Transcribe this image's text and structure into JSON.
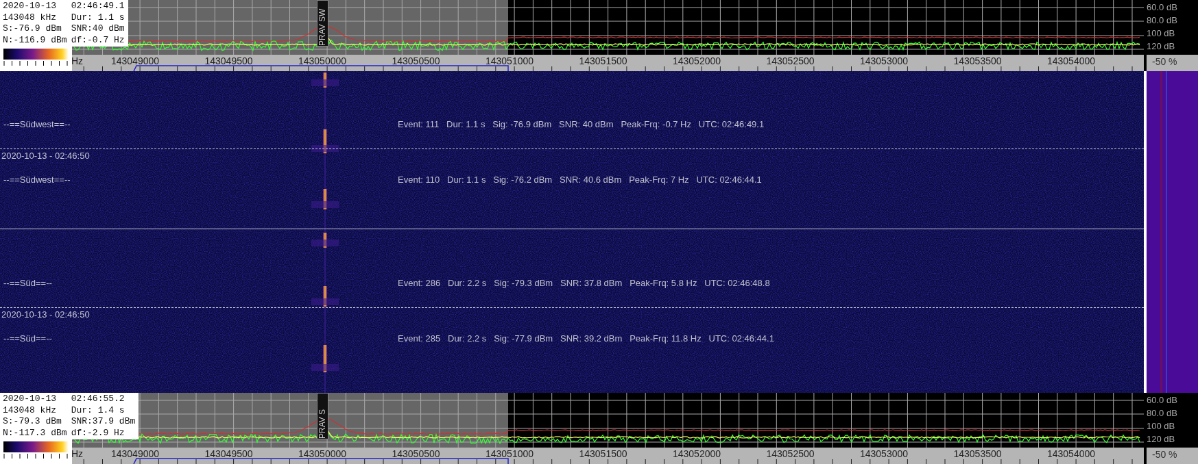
{
  "spectra": [
    {
      "info": {
        "date": "2020-10-13",
        "time": "02:46:49.1",
        "frequency": "143048 kHz",
        "duration": "Dur: 1.1 s",
        "signal": "S:-76.9 dBm",
        "snr": "SNR:40 dBm",
        "noise": "N:-116.9 dBm",
        "offset": "df:-0.7 Hz"
      },
      "marker": "PRAV SW",
      "db_labels": [
        "60.0 dB",
        "80.0 dB",
        "100 dB",
        "120 dB"
      ],
      "axis": {
        "unit": "Hz",
        "ticks": [
          "143049000",
          "143049500",
          "143050000",
          "143050500",
          "143051000",
          "143051500",
          "143052000",
          "143052500",
          "143053000",
          "143053500",
          "143054000"
        ]
      },
      "percent": "-50 %"
    },
    {
      "info": {
        "date": "2020-10-13",
        "time": "02:46:55.2",
        "frequency": "143048 kHz",
        "duration": "Dur: 1.4 s",
        "signal": "S:-79.3 dBm",
        "snr": "SNR:37.9 dBm",
        "noise": "N:-117.3 dBm",
        "offset": "df:-2.9 Hz"
      },
      "marker": "PRAV S",
      "db_labels": [
        "60.0 dB",
        "80.0 dB",
        "100 dB",
        "120 dB"
      ],
      "axis": {
        "unit": "Hz",
        "ticks": [
          "143049000",
          "143049500",
          "143050000",
          "143050500",
          "143051000",
          "143051500",
          "143052000",
          "143052500",
          "143053000",
          "143053500",
          "143054000"
        ]
      },
      "percent": "-50 %"
    }
  ],
  "waterfall": {
    "groups": [
      {
        "rows": [
          {
            "kind": "event",
            "station": "--==Südwest==--",
            "details": "Event: 111   Dur: 1.1 s   Sig: -76.9 dBm   SNR: 40 dBm   Peak-Frq: -0.7 Hz   UTC: 02:46:49.1"
          },
          {
            "kind": "timestamp",
            "text": "2020-10-13 - 02:46:50"
          },
          {
            "kind": "event",
            "station": "--==Südwest==--",
            "details": "Event: 110   Dur: 1.1 s   Sig: -76.2 dBm   SNR: 40.6 dBm   Peak-Frq: 7 Hz   UTC: 02:46:44.1"
          }
        ]
      },
      {
        "rows": [
          {
            "kind": "event",
            "station": "--==Süd==--",
            "details": "Event: 286   Dur: 2.2 s   Sig: -79.3 dBm   SNR: 37.8 dBm   Peak-Frq: 5.8 Hz   UTC: 02:46:48.8"
          },
          {
            "kind": "timestamp",
            "text": "2020-10-13 - 02:46:50"
          },
          {
            "kind": "event",
            "station": "--==Süd==--",
            "details": "Event: 285   Dur: 2.2 s   Sig: -77.9 dBm   SNR: 39.2 dBm   Peak-Frq: 11.8 Hz   UTC: 02:46:44.1"
          }
        ]
      }
    ]
  }
}
